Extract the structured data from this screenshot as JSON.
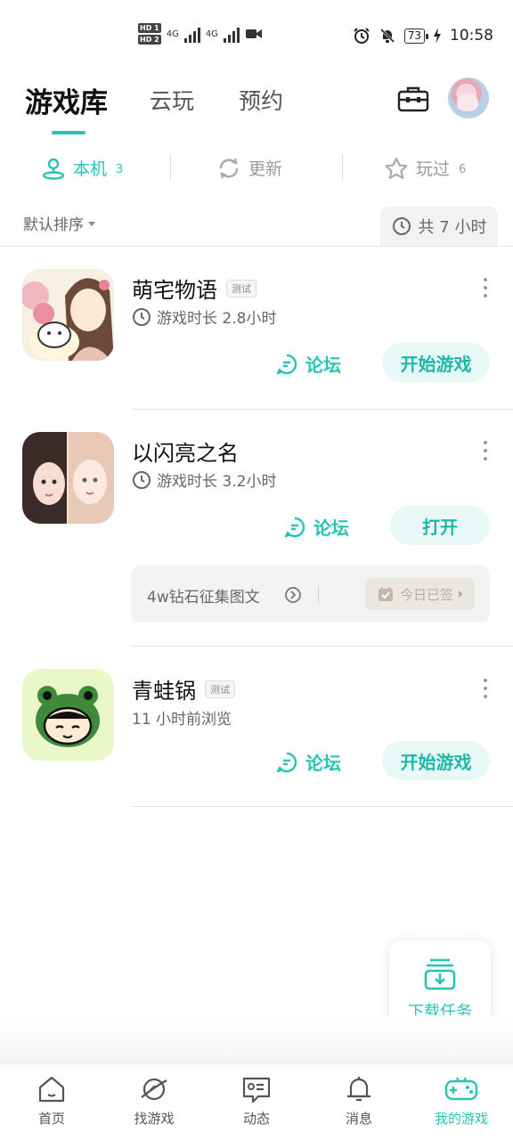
{
  "status_bar": {
    "sim1": "HD 1",
    "sim2": "HD 2",
    "net1": "4G",
    "net2": "4G",
    "battery": "73",
    "time": "10:58"
  },
  "header": {
    "tabs": [
      {
        "label": "游戏库",
        "active": true
      },
      {
        "label": "云玩",
        "active": false
      },
      {
        "label": "预约",
        "active": false
      }
    ],
    "toolbox_icon": "toolbox-icon",
    "avatar_icon": "avatar-icon"
  },
  "subtabs": [
    {
      "label": "本机",
      "count": "3",
      "icon": "location-person-icon",
      "active": true
    },
    {
      "label": "更新",
      "count": "",
      "icon": "refresh-icon",
      "active": false
    },
    {
      "label": "玩过",
      "count": "6",
      "icon": "star-icon",
      "active": false
    }
  ],
  "sort": {
    "label": "默认排序",
    "total": "共 7 小时"
  },
  "games": [
    {
      "name": "萌宅物语",
      "tag": "测试",
      "subtitle": "游戏时长 2.8小时",
      "forum": "论坛",
      "action": "开始游戏"
    },
    {
      "name": "以闪亮之名",
      "tag": "",
      "subtitle": "游戏时长 3.2小时",
      "forum": "论坛",
      "action": "打开",
      "notice": "4w钻石征集图文",
      "checkin": "今日已签"
    },
    {
      "name": "青蛙锅",
      "tag": "测试",
      "subtitle": "11 小时前浏览",
      "forum": "论坛",
      "action": "开始游戏"
    }
  ],
  "download_task": "下载任务",
  "nav": [
    {
      "label": "首页",
      "icon": "home-icon",
      "active": false
    },
    {
      "label": "找游戏",
      "icon": "planet-icon",
      "active": false
    },
    {
      "label": "动态",
      "icon": "feed-icon",
      "active": false
    },
    {
      "label": "消息",
      "icon": "bell-icon",
      "active": false
    },
    {
      "label": "我的游戏",
      "icon": "gamepad-icon",
      "active": true
    }
  ],
  "colors": {
    "accent": "#27c4b5",
    "button_bg": "#e7f8f6"
  }
}
